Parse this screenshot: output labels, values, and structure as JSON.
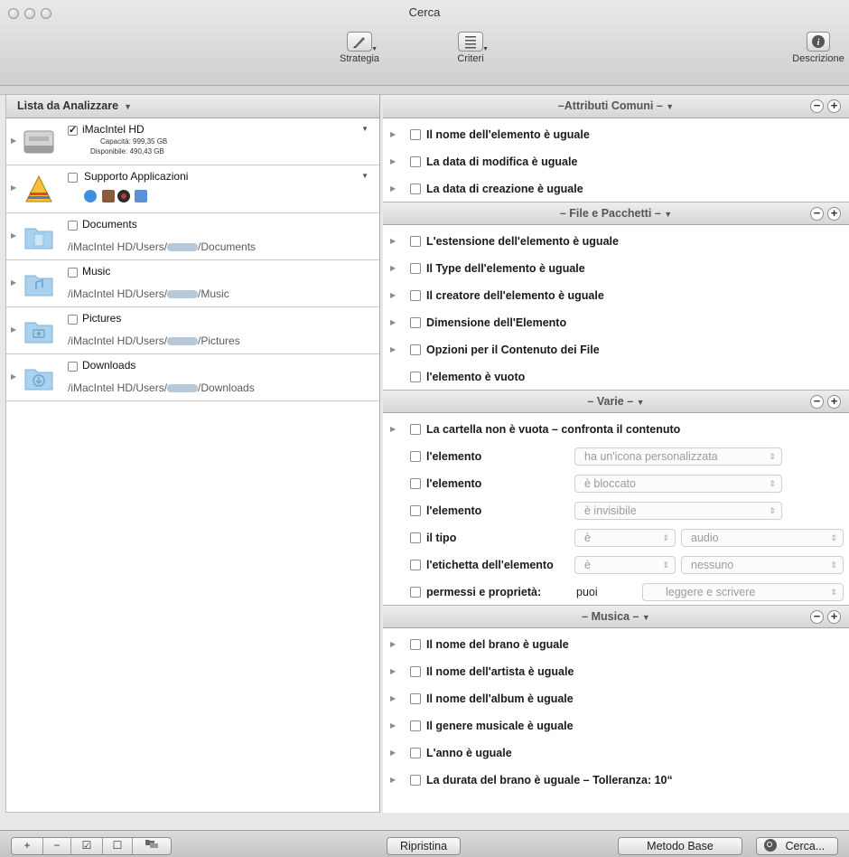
{
  "window": {
    "title": "Cerca"
  },
  "toolbar": {
    "strategy": "Strategia",
    "criteria": "Criteri",
    "description": "Descrizione"
  },
  "left": {
    "header": "Lista da Analizzare",
    "volumes": [
      {
        "name": "iMacIntel HD",
        "checked": true,
        "capacity": "Capacità: 999,35 GB",
        "available": "Disponibile: 490,43 GB"
      },
      {
        "name": "Supporto Applicazioni",
        "checked": false
      },
      {
        "name": "Documents",
        "checked": false,
        "path_start": "/iMacIntel HD/Users/",
        "path_end": "/Documents"
      },
      {
        "name": "Music",
        "checked": false,
        "path_start": "/iMacIntel HD/Users/",
        "path_end": "/Music"
      },
      {
        "name": "Pictures",
        "checked": false,
        "path_start": "/iMacIntel HD/Users/",
        "path_end": "/Pictures"
      },
      {
        "name": "Downloads",
        "checked": false,
        "path_start": "/iMacIntel HD/Users/",
        "path_end": "/Downloads"
      }
    ]
  },
  "sections": {
    "common": {
      "title": "–Attributi Comuni –",
      "rows": [
        "Il nome dell'elemento è uguale",
        "La data di modifica è uguale",
        "La data di creazione è uguale"
      ]
    },
    "files": {
      "title": "– File e Pacchetti –",
      "rows": [
        "L'estensione dell'elemento è uguale",
        "Il Type dell'elemento è uguale",
        "Il creatore dell'elemento è uguale",
        "Dimensione dell'Elemento",
        "Opzioni per il Contenuto dei File",
        "l'elemento è vuoto"
      ]
    },
    "misc": {
      "title": "– Varie –",
      "folder": "La cartella non è vuota – confronta il contenuto",
      "item1": "l'elemento",
      "item1_value": "ha un'icona personalizzata",
      "item2": "l'elemento",
      "item2_value": "è bloccato",
      "item3": "l'elemento",
      "item3_value": "è invisibile",
      "type": "il tipo",
      "type_op": "è",
      "type_value": "audio",
      "label": "l'etichetta dell'elemento",
      "label_op": "è",
      "label_value": "nessuno",
      "perm": "permessi e proprietà:",
      "perm_who": "puoi",
      "perm_value": "leggere e scrivere"
    },
    "music": {
      "title": "– Musica –",
      "rows": [
        "Il nome del brano è uguale",
        "Il nome dell'artista è uguale",
        "Il nome dell'album è uguale",
        "Il genere musicale è uguale",
        "L'anno è uguale",
        "La durata del brano è uguale – Tolleranza: 10“"
      ]
    }
  },
  "bottom": {
    "reset": "Ripristina",
    "basic": "Metodo Base",
    "search": "Cerca..."
  }
}
